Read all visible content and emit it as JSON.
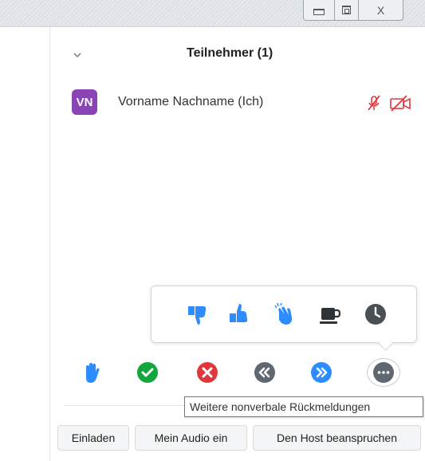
{
  "window": {
    "controls": {
      "close_glyph": "X"
    }
  },
  "panel": {
    "title": "Teilnehmer (1)",
    "collapse_icon": "chevron-down-icon"
  },
  "participants": [
    {
      "initials": "VN",
      "name": "Vorname Nachname (Ich)",
      "avatar_color": "#8b44b6",
      "mic": "muted",
      "camera": "off"
    }
  ],
  "reactions": {
    "items": [
      "thumbs-down",
      "thumbs-up",
      "clap",
      "coffee",
      "clock"
    ],
    "color": "#2d8cff"
  },
  "feedback_bar": {
    "items": [
      {
        "name": "raise-hand",
        "color": "#2d8cff"
      },
      {
        "name": "yes",
        "color": "#12a63c"
      },
      {
        "name": "no",
        "color": "#e0373a"
      },
      {
        "name": "go-slower",
        "color": "#5f6770"
      },
      {
        "name": "go-faster",
        "color": "#2d8cff"
      },
      {
        "name": "more",
        "color": "#5f6770"
      }
    ]
  },
  "tooltip": {
    "text": "Weitere nonverbale Rückmeldungen"
  },
  "actions": {
    "invite": "Einladen",
    "unmute": "Mein Audio ein",
    "claim_host": "Den Host beanspruchen"
  }
}
